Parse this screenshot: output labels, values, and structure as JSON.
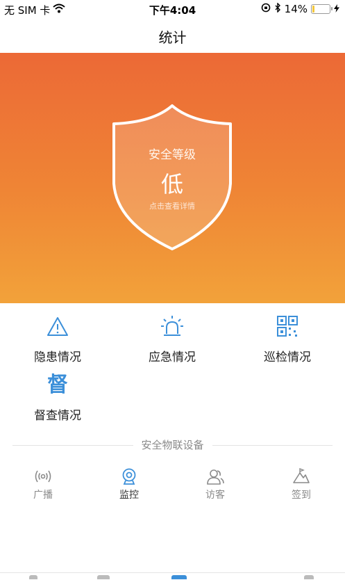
{
  "status": {
    "carrier": "无 SIM 卡",
    "time": "下午4:04",
    "battery": "14%",
    "battery_level": 0.14
  },
  "nav": {
    "title": "统计"
  },
  "hero": {
    "level_label": "安全等级",
    "level_value": "低",
    "hint": "点击查看详情",
    "colors": {
      "top": "#ec6936",
      "bottom": "#f2a23a"
    }
  },
  "grid": [
    {
      "label": "隐患情况",
      "icon": "warning-triangle-icon"
    },
    {
      "label": "应急情况",
      "icon": "alarm-siren-icon"
    },
    {
      "label": "巡检情况",
      "icon": "qr-code-icon"
    },
    {
      "label": "督查情况",
      "icon": "supervise-char-icon",
      "glyph": "督"
    }
  ],
  "iot": {
    "title": "安全物联设备",
    "items": [
      {
        "label": "广播",
        "icon": "broadcast-icon",
        "active": false
      },
      {
        "label": "监控",
        "icon": "camera-icon",
        "active": true
      },
      {
        "label": "访客",
        "icon": "visitor-icon",
        "active": false
      },
      {
        "label": "签到",
        "icon": "checkin-icon",
        "active": false
      }
    ]
  },
  "colors": {
    "accent": "#3b8fd9",
    "muted": "#8a8a8a"
  }
}
